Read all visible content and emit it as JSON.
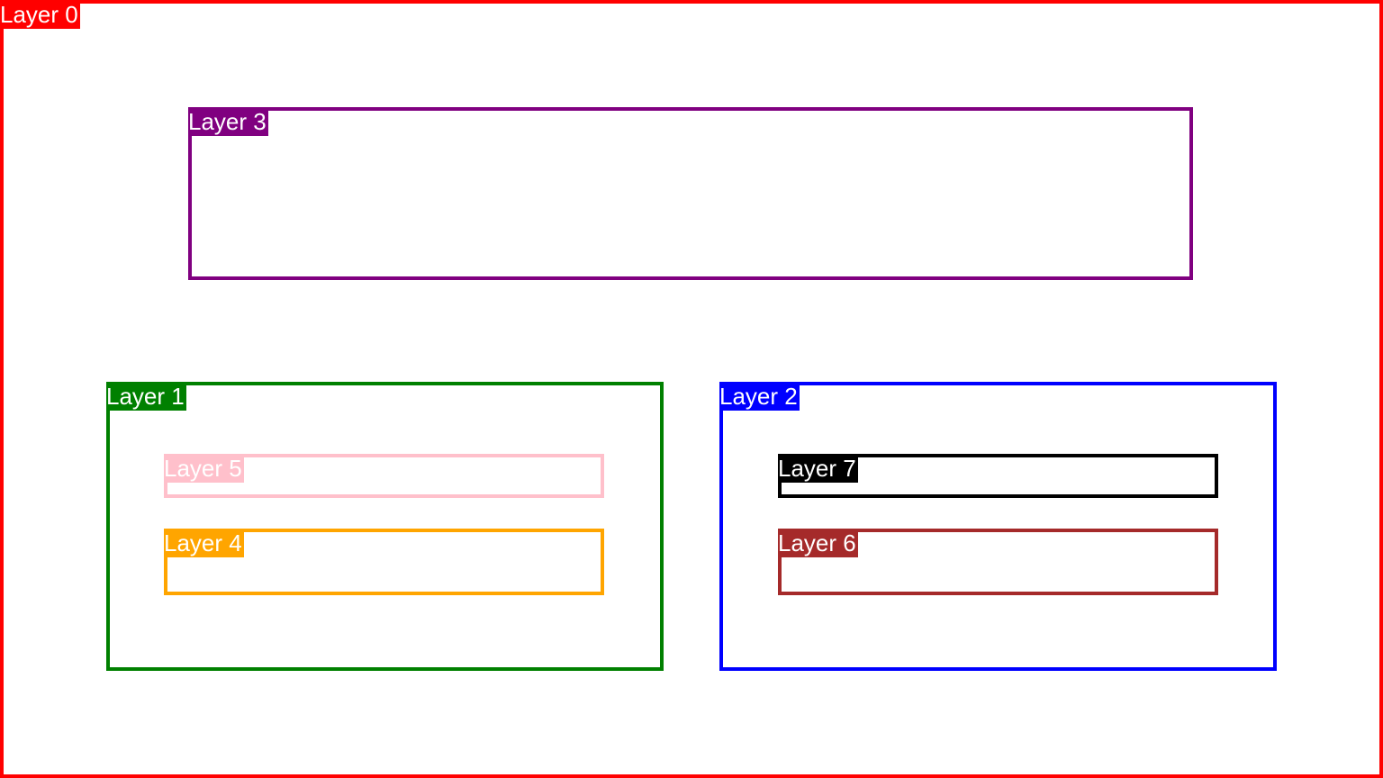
{
  "layers": [
    {
      "label": "Layer 0",
      "color": "#ff0000"
    },
    {
      "label": "Layer 1",
      "color": "#008000"
    },
    {
      "label": "Layer 2",
      "color": "#0000ff"
    },
    {
      "label": "Layer 3",
      "color": "#800080"
    },
    {
      "label": "Layer 4",
      "color": "#ffa500"
    },
    {
      "label": "Layer 5",
      "color": "#ffc0cb"
    },
    {
      "label": "Layer 6",
      "color": "#a52a2a"
    },
    {
      "label": "Layer 7",
      "color": "#000000"
    }
  ]
}
